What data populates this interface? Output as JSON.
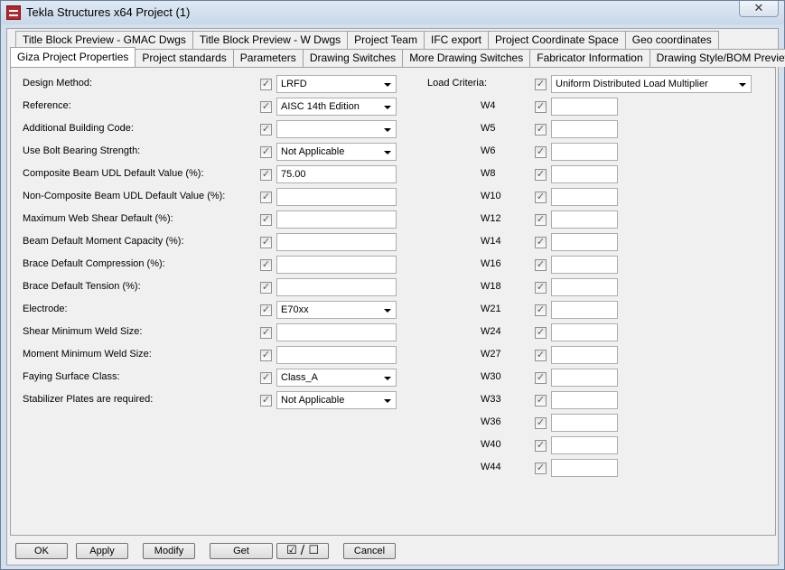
{
  "window": {
    "title": "Tekla Structures x64  Project (1)",
    "close_glyph": "✕"
  },
  "tabs_back": [
    "Title Block Preview - GMAC Dwgs",
    "Title Block Preview - W Dwgs",
    "Project Team",
    "IFC export",
    "Project Coordinate Space",
    "Geo coordinates"
  ],
  "tabs_front": [
    "Giza Project Properties",
    "Project standards",
    "Parameters",
    "Drawing Switches",
    "More Drawing Switches",
    "Fabricator Information",
    "Drawing Style/BOM Preview"
  ],
  "left_fields": [
    {
      "label": "Design Method:",
      "type": "combo",
      "value": "LRFD"
    },
    {
      "label": "Reference:",
      "type": "combo",
      "value": "AISC 14th Edition"
    },
    {
      "label": "Additional Building Code:",
      "type": "combo",
      "value": ""
    },
    {
      "label": "Use Bolt Bearing Strength:",
      "type": "combo",
      "value": "Not Applicable"
    },
    {
      "label": "Composite Beam UDL Default Value (%):",
      "type": "text",
      "value": "75.00"
    },
    {
      "label": "Non-Composite Beam UDL Default Value (%):",
      "type": "text",
      "value": ""
    },
    {
      "label": "Maximum Web Shear Default (%):",
      "type": "text",
      "value": ""
    },
    {
      "label": "Beam Default Moment Capacity (%):",
      "type": "text",
      "value": ""
    },
    {
      "label": "Brace Default Compression (%):",
      "type": "text",
      "value": ""
    },
    {
      "label": "Brace Default Tension (%):",
      "type": "text",
      "value": ""
    },
    {
      "label": "Electrode:",
      "type": "combo",
      "value": "E70xx"
    },
    {
      "label": "Shear Minimum Weld Size:",
      "type": "text",
      "value": ""
    },
    {
      "label": "Moment Minimum Weld Size:",
      "type": "text",
      "value": ""
    },
    {
      "label": "Faying Surface Class:",
      "type": "combo",
      "value": "Class_A"
    },
    {
      "label": "Stabilizer Plates are required:",
      "type": "combo",
      "value": "Not Applicable"
    }
  ],
  "load_criteria": {
    "label": "Load Criteria:",
    "value": "Uniform Distributed Load Multiplier"
  },
  "w_fields": [
    {
      "label": "W4",
      "value": ""
    },
    {
      "label": "W5",
      "value": ""
    },
    {
      "label": "W6",
      "value": ""
    },
    {
      "label": "W8",
      "value": ""
    },
    {
      "label": "W10",
      "value": ""
    },
    {
      "label": "W12",
      "value": ""
    },
    {
      "label": "W14",
      "value": ""
    },
    {
      "label": "W16",
      "value": ""
    },
    {
      "label": "W18",
      "value": ""
    },
    {
      "label": "W21",
      "value": ""
    },
    {
      "label": "W24",
      "value": ""
    },
    {
      "label": "W27",
      "value": ""
    },
    {
      "label": "W30",
      "value": ""
    },
    {
      "label": "W33",
      "value": ""
    },
    {
      "label": "W36",
      "value": ""
    },
    {
      "label": "W40",
      "value": ""
    },
    {
      "label": "W44",
      "value": ""
    }
  ],
  "check_glyph": "✓",
  "buttons": {
    "ok": "OK",
    "apply": "Apply",
    "modify": "Modify",
    "get": "Get",
    "toggle": "☑ / ☐",
    "cancel": "Cancel"
  }
}
